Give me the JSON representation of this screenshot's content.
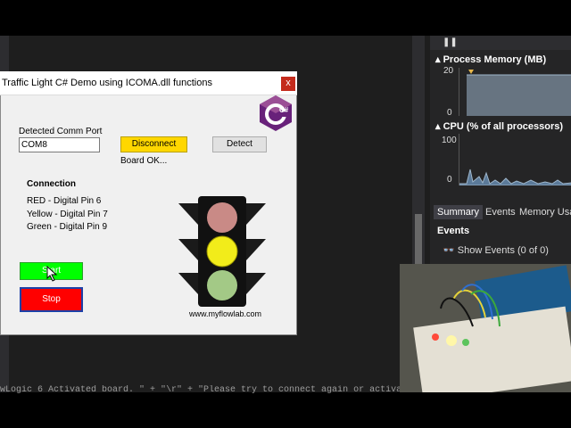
{
  "dialog": {
    "title": "Traffic Light C# Demo using ICOMA.dll functions",
    "close_label": "x",
    "port_label": "Detected Comm Port",
    "port_value": "COM8",
    "disconnect_label": "Disconnect",
    "detect_label": "Detect",
    "status_text": "Board OK...",
    "connection_header": "Connection",
    "pins": {
      "red": "RED - Digital Pin 6",
      "yellow": "Yellow - Digital Pin 7",
      "green": "Green - Digital Pin 9"
    },
    "start_label": "Start",
    "stop_label": "Stop",
    "website": "www.myflowlab.com",
    "logo_text": "C#",
    "colors": {
      "disconnect_bg": "#ffd700",
      "start_bg": "#00ff00",
      "stop_bg": "#ff0000",
      "red_lamp": "#c98a86",
      "yellow_lamp": "#f2ec1a",
      "green_lamp": "#a3c986"
    }
  },
  "diagnostics": {
    "memory_title": "Process Memory (MB)",
    "memory_max": "20",
    "memory_min": "0",
    "cpu_title": "CPU (% of all processors)",
    "cpu_max": "100",
    "cpu_min": "0",
    "tabs": [
      "Summary",
      "Events",
      "Memory Usag"
    ],
    "events_header": "Events",
    "show_events": "Show Events (0 of 0)"
  },
  "editor": {
    "code_line": "wLogic 6 Activated board. \" + \"\\r\" + \"Please try to connect again or activate"
  }
}
